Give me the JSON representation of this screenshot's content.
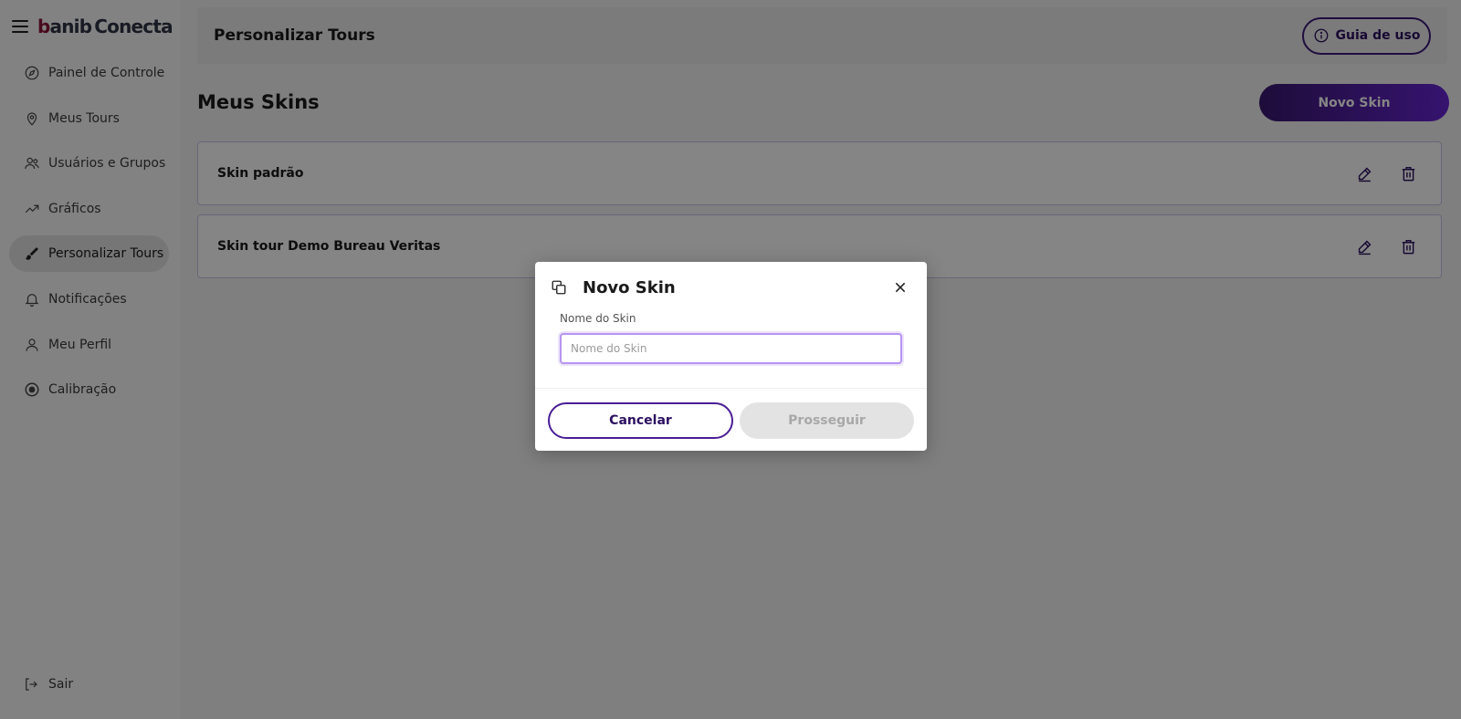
{
  "brand": {
    "logo_b": "b",
    "logo_rest": "anib",
    "logo_conecta": "Conecta"
  },
  "sidebar": {
    "items": [
      {
        "label": "Painel de Controle",
        "icon": "compass-icon"
      },
      {
        "label": "Meus Tours",
        "icon": "map-pin-icon"
      },
      {
        "label": "Usuários e Grupos",
        "icon": "users-icon"
      },
      {
        "label": "Gráficos",
        "icon": "trending-up-icon"
      },
      {
        "label": "Personalizar Tours",
        "icon": "brush-icon",
        "active": true
      },
      {
        "label": "Notificações",
        "icon": "bell-icon"
      },
      {
        "label": "Meu Perfil",
        "icon": "user-icon"
      },
      {
        "label": "Calibração",
        "icon": "target-icon"
      }
    ],
    "logout_label": "Sair"
  },
  "header": {
    "title": "Personalizar Tours",
    "guide_label": "Guia de uso"
  },
  "content": {
    "section_title": "Meus Skins",
    "new_button_label": "Novo Skin",
    "skins": [
      {
        "name": "Skin padrão"
      },
      {
        "name": "Skin tour Demo Bureau Veritas"
      }
    ]
  },
  "modal": {
    "title": "Novo Skin",
    "field_label": "Nome do Skin",
    "field_placeholder": "Nome do Skin",
    "field_value": "",
    "cancel_label": "Cancelar",
    "continue_label": "Prosseguir"
  },
  "colors": {
    "accent": "#3d1a78",
    "accent_gradient_end": "#6826d6",
    "logo_b": "#8b1538",
    "disabled_bg": "#e3e3e3"
  }
}
